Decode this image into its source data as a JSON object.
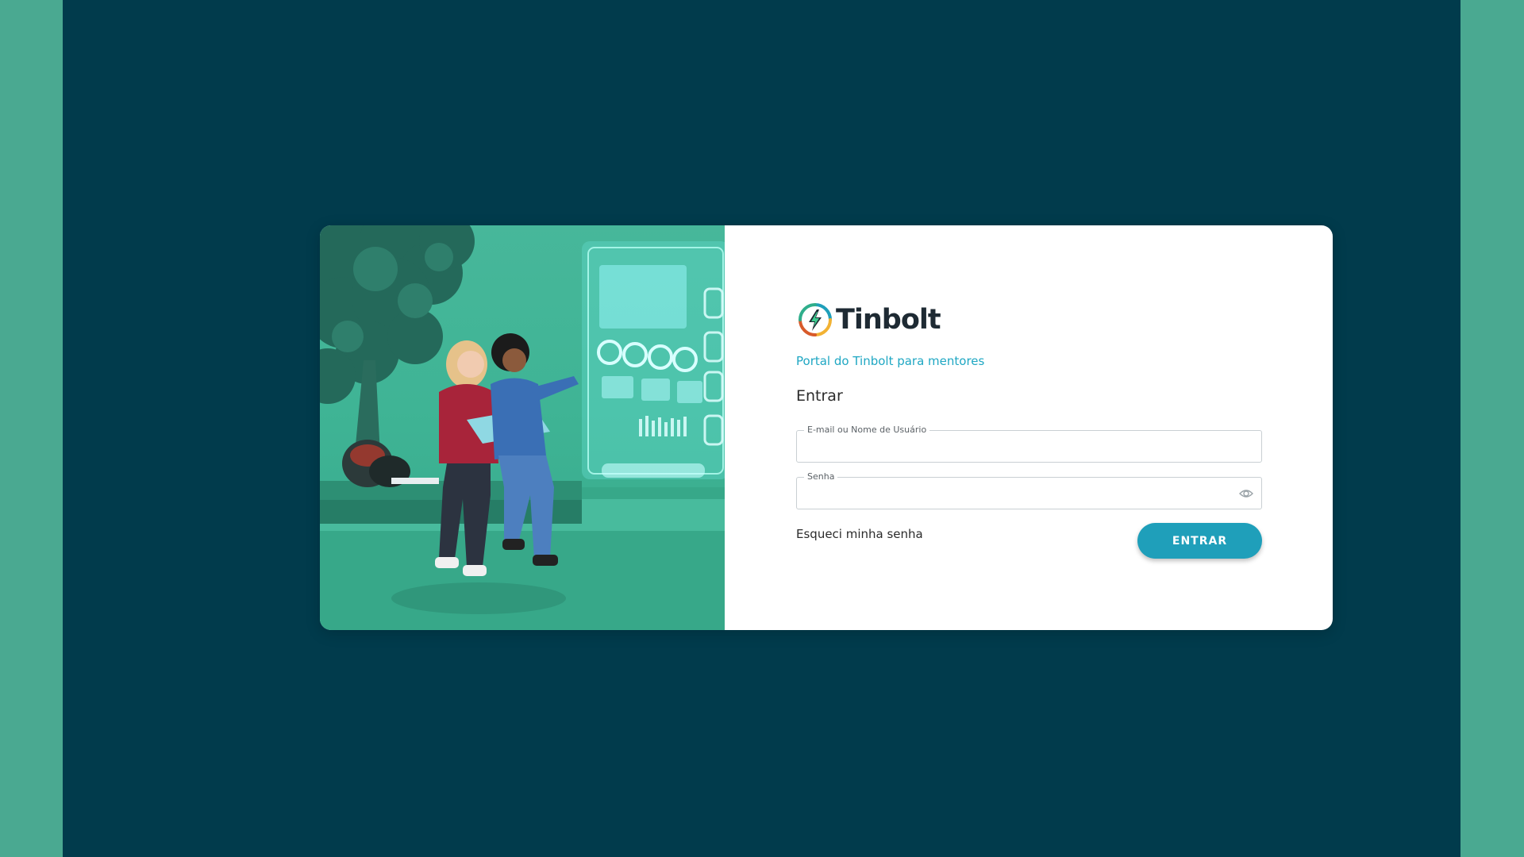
{
  "colors": {
    "outer_background": "#4aa991",
    "stage_background": "#013b4c",
    "accent": "#1f9fba",
    "subtitle": "#1fa7c3"
  },
  "brand": {
    "name": "Tinbolt",
    "logo_icon": "lightning-bolt-icon"
  },
  "login": {
    "subtitle": "Portal do Tinbolt para mentores",
    "heading": "Entrar",
    "email_label": "E-mail ou Nome de Usuário",
    "email_value": "",
    "password_label": "Senha",
    "password_value": "",
    "password_toggle_icon": "eye-icon",
    "forgot_password": "Esqueci minha senha",
    "submit_label": "ENTRAR"
  }
}
